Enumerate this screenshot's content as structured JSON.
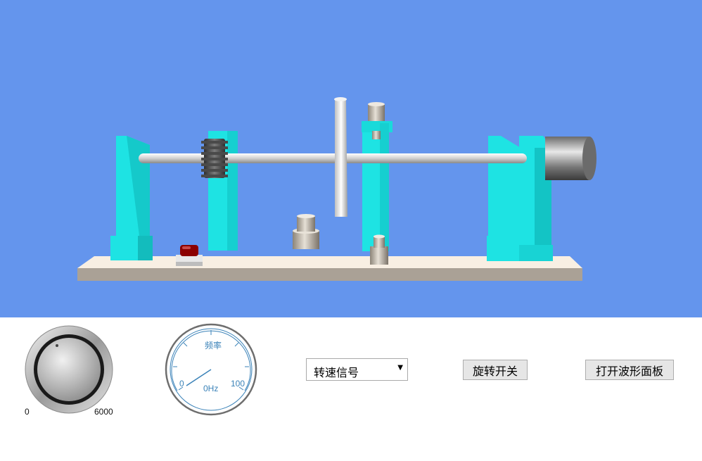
{
  "knob": {
    "min_label": "0",
    "max_label": "6000"
  },
  "gauge": {
    "title": "频率",
    "min_label": "0",
    "max_label": "100",
    "value_text": "0Hz"
  },
  "signal_select": {
    "selected": "转速信号"
  },
  "buttons": {
    "rotate_switch": "旋转开关",
    "open_waveform_panel": "打开波形面板"
  },
  "colors": {
    "scene_bg": "#6495ED",
    "support_cyan": "#1EE3E3",
    "base_plate": "#F8EFE3"
  }
}
